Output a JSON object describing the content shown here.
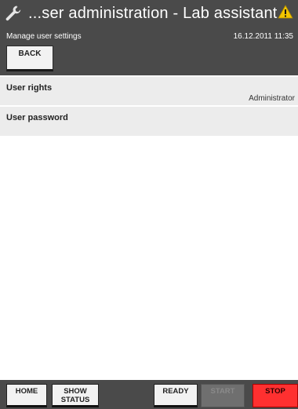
{
  "header": {
    "title": "...ser administration - Lab assistant",
    "subtitle": "Manage user settings",
    "datetime": "16.12.2011 11:35",
    "back_label": "BACK",
    "icons": {
      "left": "wrench-icon",
      "right": "warning-icon"
    }
  },
  "settings": [
    {
      "label": "User rights",
      "value": "Administrator"
    },
    {
      "label": "User password",
      "value": ""
    }
  ],
  "footer": {
    "home_label": "HOME",
    "show_status_line1": "SHOW",
    "show_status_line2": "STATUS",
    "ready_label": "READY",
    "start_label": "START",
    "stop_label": "STOP"
  },
  "colors": {
    "header_bg": "#4a4a4a",
    "row_bg": "#ececec",
    "stop": "#ff3030",
    "warning": "#f2c500"
  }
}
